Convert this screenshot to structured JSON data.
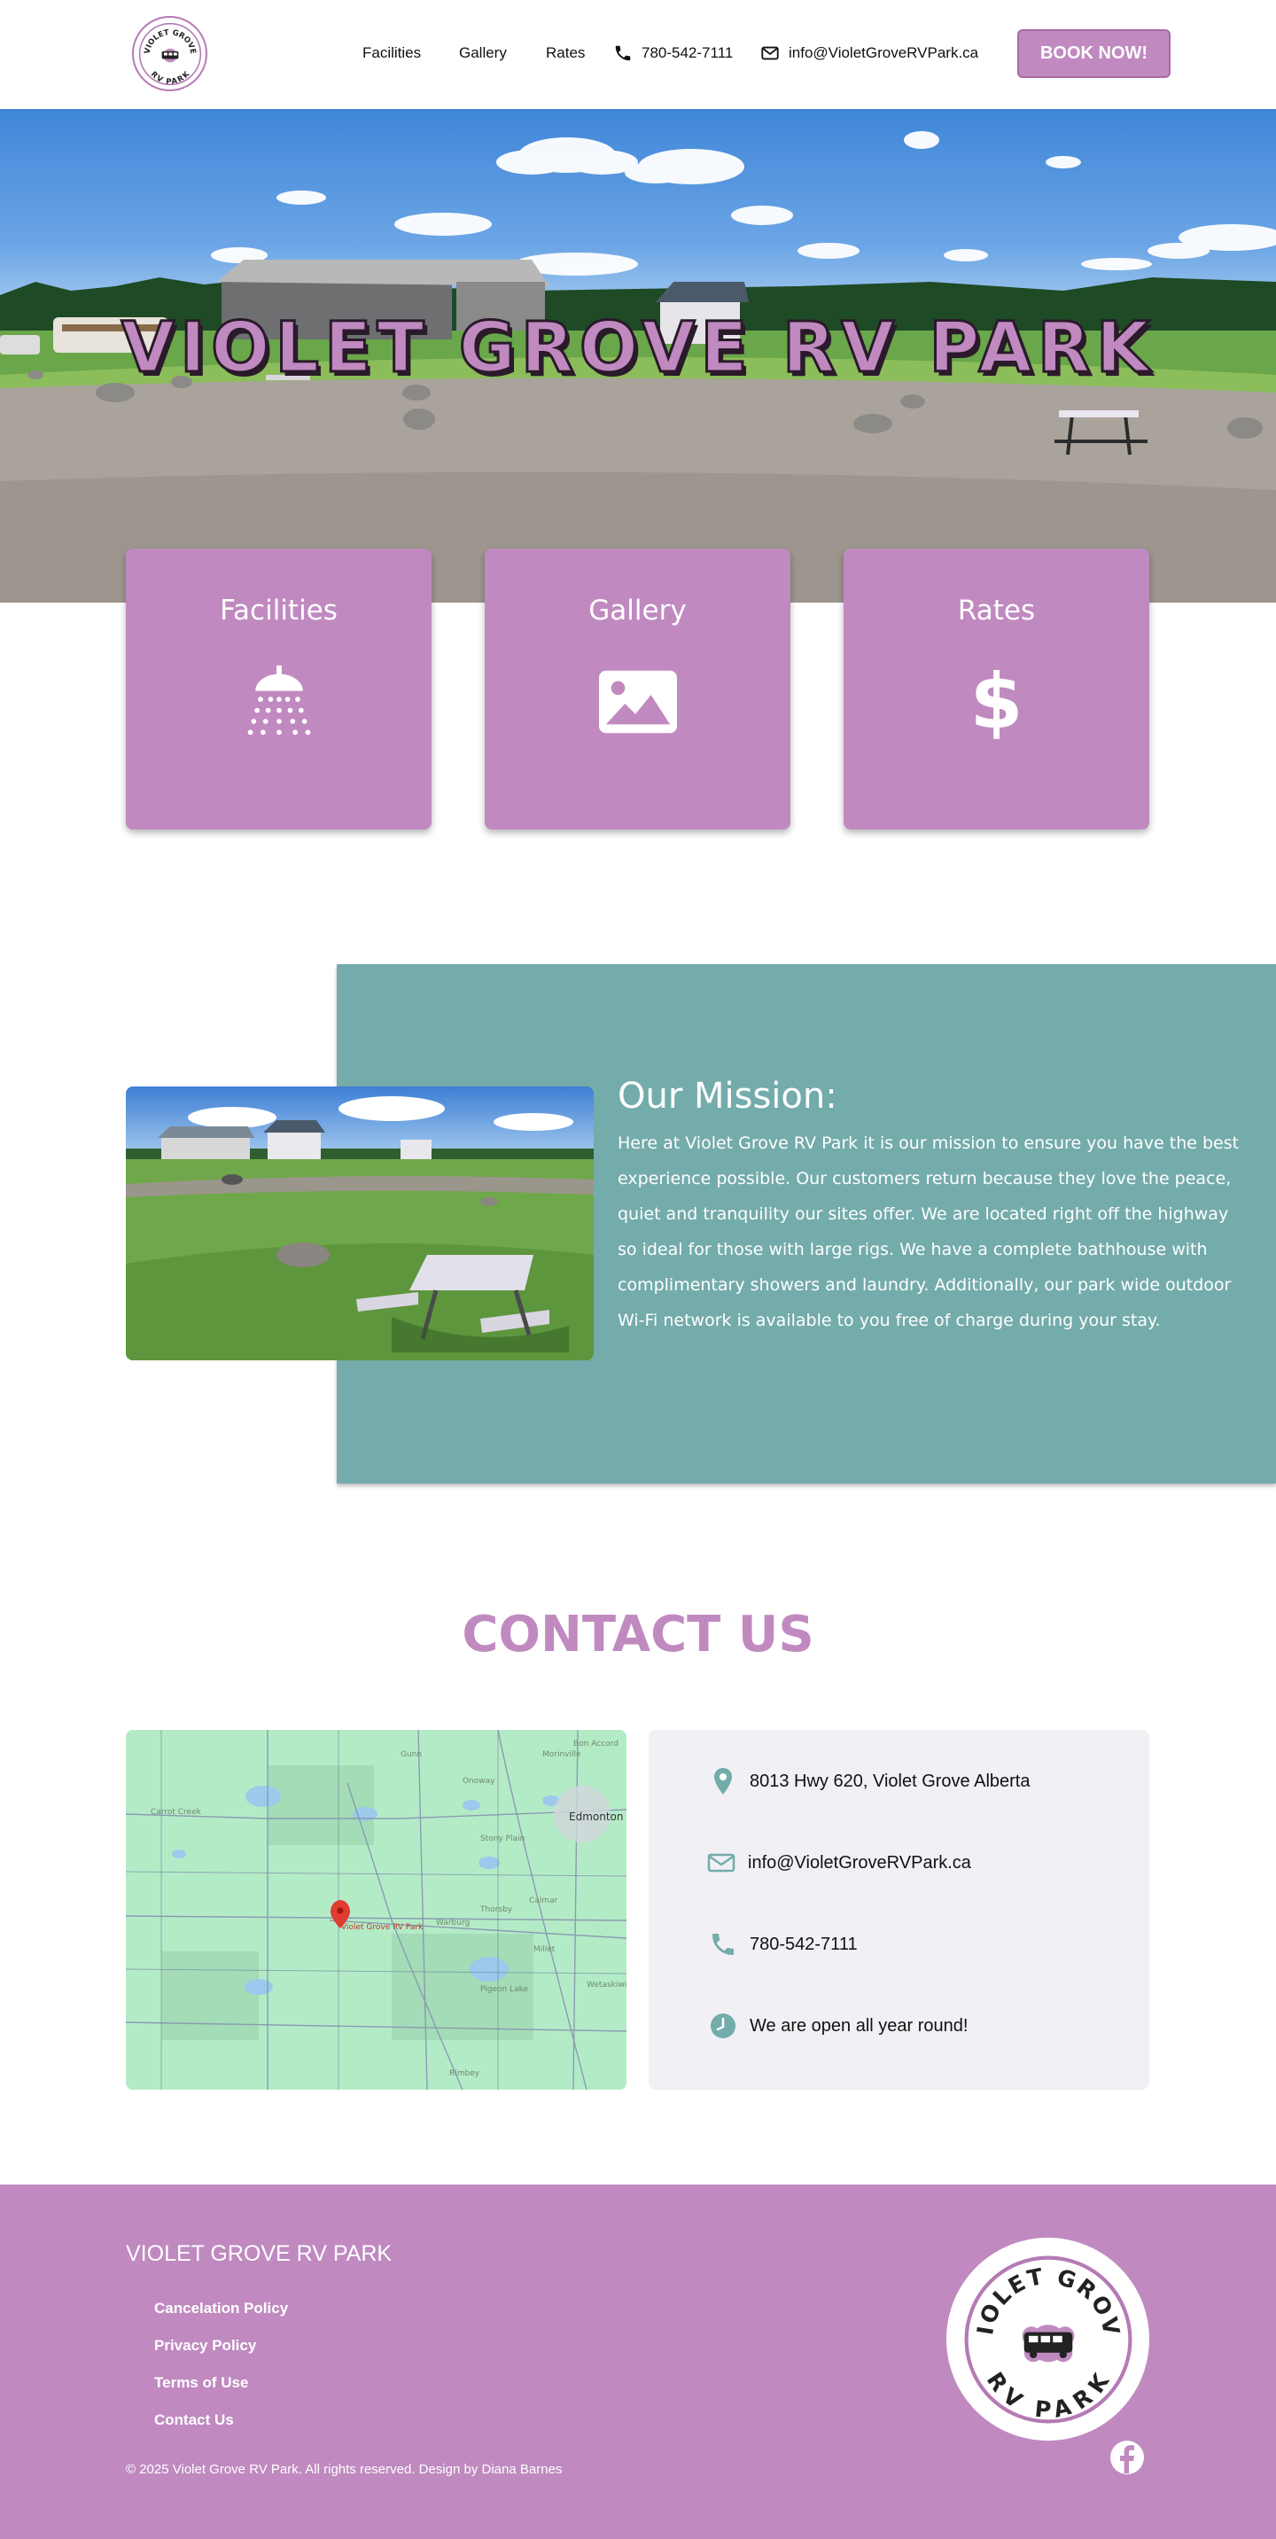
{
  "header": {
    "logo": {
      "line1": "VIOLET GROVE",
      "line2": "RV PARK"
    },
    "nav": [
      "Facilities",
      "Gallery",
      "Rates"
    ],
    "phone": "780-542-7111",
    "email": "info@VioletGroveRVPark.ca",
    "book_label": "BOOK NOW!"
  },
  "hero": {
    "title": "VIOLET GROVE RV PARK"
  },
  "cards": [
    {
      "title": "Facilities",
      "icon": "shower-icon"
    },
    {
      "title": "Gallery",
      "icon": "image-icon"
    },
    {
      "title": "Rates",
      "icon": "dollar-icon"
    }
  ],
  "mission": {
    "title": "Our Mission:",
    "text": "Here at Violet Grove RV Park it is our mission to ensure you have the best experience possible. Our customers return because they love the peace, quiet and tranquility our sites offer. We are located right off the highway so ideal for those with large rigs. We have a complete bathhouse with complimentary showers and laundry. Additionally, our park wide outdoor Wi-Fi network is available to you free of charge during your stay."
  },
  "contact": {
    "title": "CONTACT US",
    "map": {
      "labels": [
        "Edmonton",
        "Violet Grove RV Park",
        "Stony Plain",
        "Gunn",
        "Onoway",
        "Morinville",
        "Bon Accord",
        "Carrot Creek",
        "Warburg",
        "Thorsby",
        "Calmar",
        "Millet",
        "Wetaskiwin",
        "Pigeon Lake",
        "Rimbey"
      ]
    },
    "address": "8013 Hwy 620, Violet Grove Alberta",
    "email": "info@VioletGroveRVPark.ca",
    "phone": "780-542-7111",
    "hours": "We are open all year round!"
  },
  "footer": {
    "brand": "VIOLET GROVE RV PARK",
    "links": [
      "Cancelation Policy",
      "Privacy Policy",
      "Terms of Use",
      "Contact Us"
    ],
    "copyright": "© 2025 Violet Grove RV Park. All rights reserved. Design by Diana Barnes",
    "logo": {
      "line1": "VIOLET GROVE",
      "line2": "RV PARK"
    }
  },
  "colors": {
    "brand": "#c08ac0",
    "teal": "#74abab",
    "contact_bg": "#f0f0f5"
  }
}
